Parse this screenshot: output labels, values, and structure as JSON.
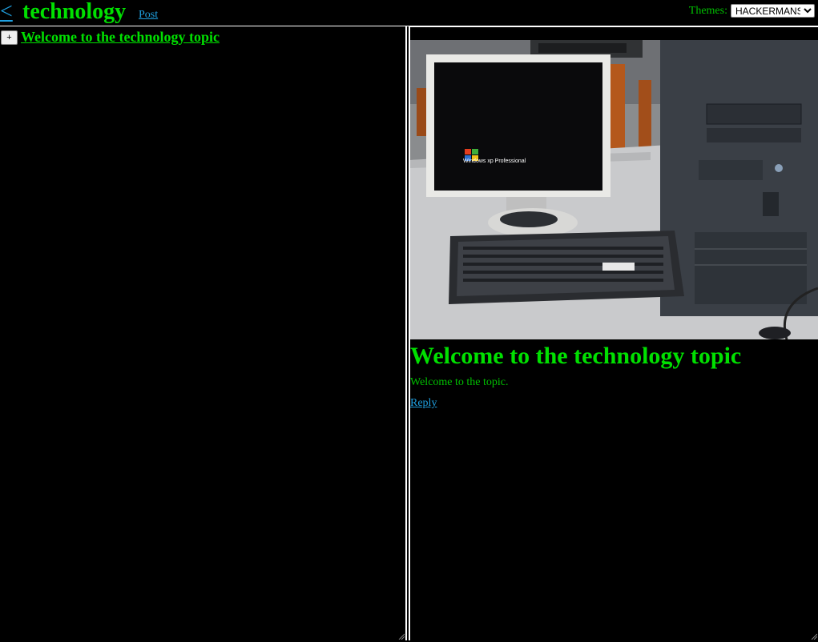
{
  "header": {
    "back_label": "<",
    "title": "technology",
    "post_label": "Post",
    "themes_label": "Themes:",
    "theme_selected": "HACKERMANS"
  },
  "thread_list": {
    "expand_label": "+",
    "items": [
      {
        "title": "Welcome to the technology topic"
      }
    ]
  },
  "post": {
    "image_subject": "desktop-computer-photo",
    "image_screen_text": "Windows xp Professional",
    "title": "Welcome to the technology topic",
    "body": "Welcome to the topic.",
    "reply_label": "Reply"
  },
  "colors": {
    "background": "#000000",
    "heading_green": "#00e000",
    "text_green": "#00c000",
    "link_blue": "#1fa0e0",
    "border": "#ffffff"
  }
}
